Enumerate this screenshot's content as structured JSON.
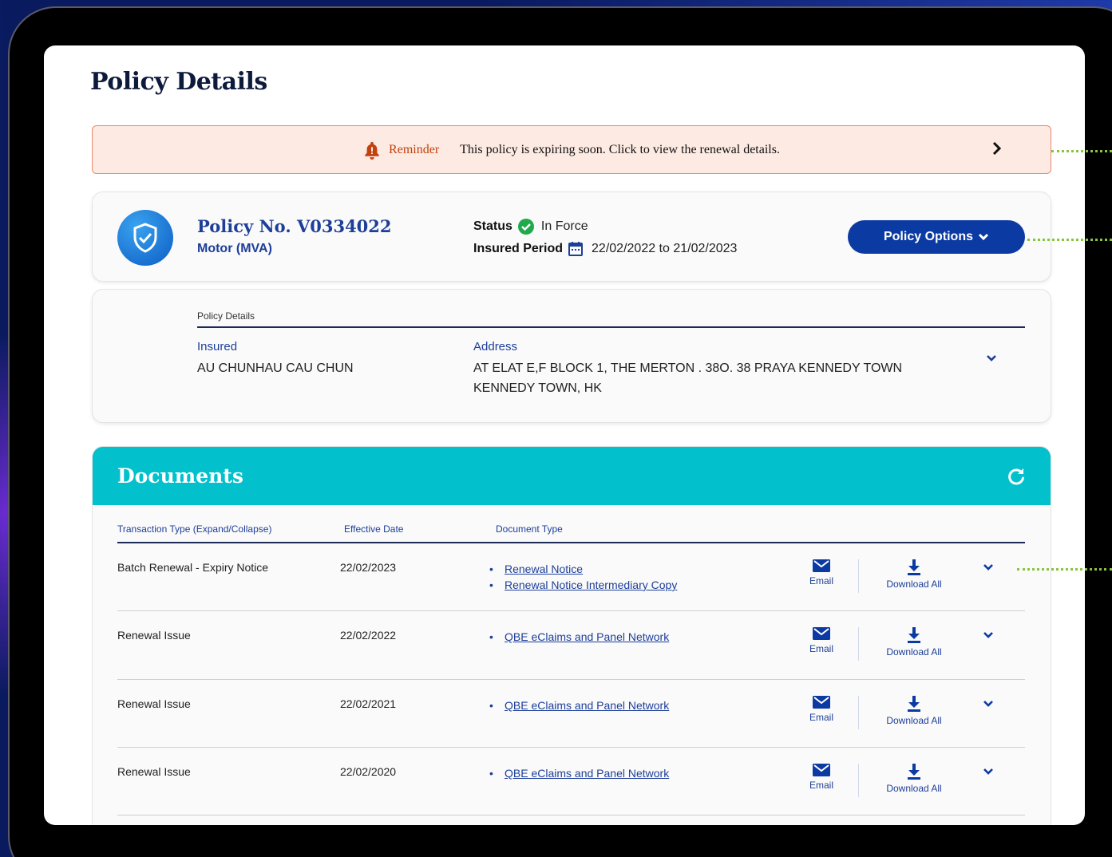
{
  "page": {
    "title": "Policy Details"
  },
  "reminder": {
    "label": "Reminder",
    "text": "This policy is expiring soon. Click to view the renewal details."
  },
  "policy": {
    "number": "Policy No. V0334022",
    "line": "Motor (MVA)",
    "status_label": "Status",
    "status_value": "In Force",
    "period_label": "Insured Period",
    "period_value": "22/02/2022 to 21/02/2023",
    "options_button": "Policy Options"
  },
  "details": {
    "heading": "Policy Details",
    "insured_label": "Insured",
    "insured_value": "AU CHUNHAU CAU CHUN",
    "address_label": "Address",
    "address_line1": "AT ELAT E,F BLOCK 1, THE MERTON . 38O. 38 PRAYA KENNEDY TOWN",
    "address_line2": "KENNEDY TOWN, HK"
  },
  "documents": {
    "title": "Documents",
    "columns": {
      "type": "Transaction Type (Expand/Collapse)",
      "date": "Effective Date",
      "doctype": "Document Type"
    },
    "email_label": "Email",
    "download_label": "Download All",
    "rows": [
      {
        "type": "Batch Renewal - Expiry Notice",
        "date": "22/02/2023",
        "docs": [
          "Renewal Notice",
          "Renewal Notice Intermediary Copy"
        ]
      },
      {
        "type": "Renewal Issue",
        "date": "22/02/2022",
        "docs": [
          "QBE eClaims and Panel Network"
        ]
      },
      {
        "type": "Renewal Issue",
        "date": "22/02/2021",
        "docs": [
          "QBE eClaims and Panel Network"
        ]
      },
      {
        "type": "Renewal Issue",
        "date": "22/02/2020",
        "docs": [
          "QBE eClaims and Panel Network"
        ]
      }
    ]
  },
  "colors": {
    "accent": "#0b3aa3",
    "teal": "#02c0cc",
    "reminder_bg": "#fdeae3",
    "success": "#1faa4b"
  },
  "icons": [
    "bell-icon",
    "chevron-right-icon",
    "shield-check-icon",
    "check-circle-icon",
    "calendar-icon",
    "chevron-down-icon",
    "refresh-icon",
    "envelope-icon",
    "download-icon"
  ]
}
